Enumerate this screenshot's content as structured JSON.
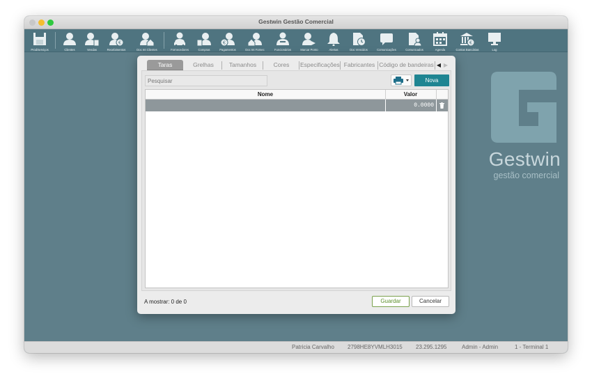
{
  "window": {
    "title": "Gestwin Gestão Comercial"
  },
  "toolbar": {
    "items": [
      {
        "label": "Prod/serviços",
        "icon": "product-icon"
      },
      {
        "label": "Clientes",
        "icon": "person-icon"
      },
      {
        "label": "Vendas",
        "icon": "person-doc-icon"
      },
      {
        "label": "Recebimentos",
        "icon": "person-euro-icon"
      },
      {
        "label": "Doc Int Clientes",
        "icon": "person-house-icon"
      },
      {
        "label": "Fornecedores",
        "icon": "person-truck-icon"
      },
      {
        "label": "Compras",
        "icon": "person-doc-icon"
      },
      {
        "label": "Pagamentos",
        "icon": "person-euro-icon"
      },
      {
        "label": "Doc Int Fornec",
        "icon": "person-house-icon"
      },
      {
        "label": "Funcionários",
        "icon": "person-group-icon"
      },
      {
        "label": "Marcar Ponto",
        "icon": "person-clock-icon"
      },
      {
        "label": "Alertas",
        "icon": "bell-icon"
      },
      {
        "label": "Doc Vencidos",
        "icon": "doc-clock-icon"
      },
      {
        "label": "Comunicações",
        "icon": "chat-icon"
      },
      {
        "label": "Comunicados",
        "icon": "doc-person-icon"
      },
      {
        "label": "Agenda",
        "icon": "calendar-icon"
      },
      {
        "label": "Contas Bancárias",
        "icon": "bank-icon"
      },
      {
        "label": "Log",
        "icon": "monitor-icon"
      }
    ]
  },
  "brand": {
    "name": "Gestwin",
    "tagline": "gestão comercial"
  },
  "dialog": {
    "tabs": [
      "Taras",
      "Grelhas",
      "Tamanhos",
      "Cores",
      "Especificações",
      "Fabricantes",
      "Código de bandeiras"
    ],
    "active_tab": "Taras",
    "search_placeholder": "Pesquisar",
    "new_button": "Nova",
    "table": {
      "columns": [
        "Nome",
        "Valor"
      ],
      "rows": [
        {
          "nome": "",
          "valor": "0.0000"
        }
      ]
    },
    "count_text": "A mostrar: 0 de 0",
    "save_button": "Guardar",
    "cancel_button": "Cancelar"
  },
  "statusbar": {
    "user": "Patricia Carvalho",
    "code": "2798HE8YVMLH3015",
    "number": "23.295.1295",
    "role": "Admin - Admin",
    "terminal": "1 - Terminal 1"
  },
  "colors": {
    "desktop": "#5f7f8a",
    "toolbar": "#4f7480",
    "accent": "#1f8592",
    "save_border": "#7aa14c",
    "selected_row": "#8e979b"
  }
}
